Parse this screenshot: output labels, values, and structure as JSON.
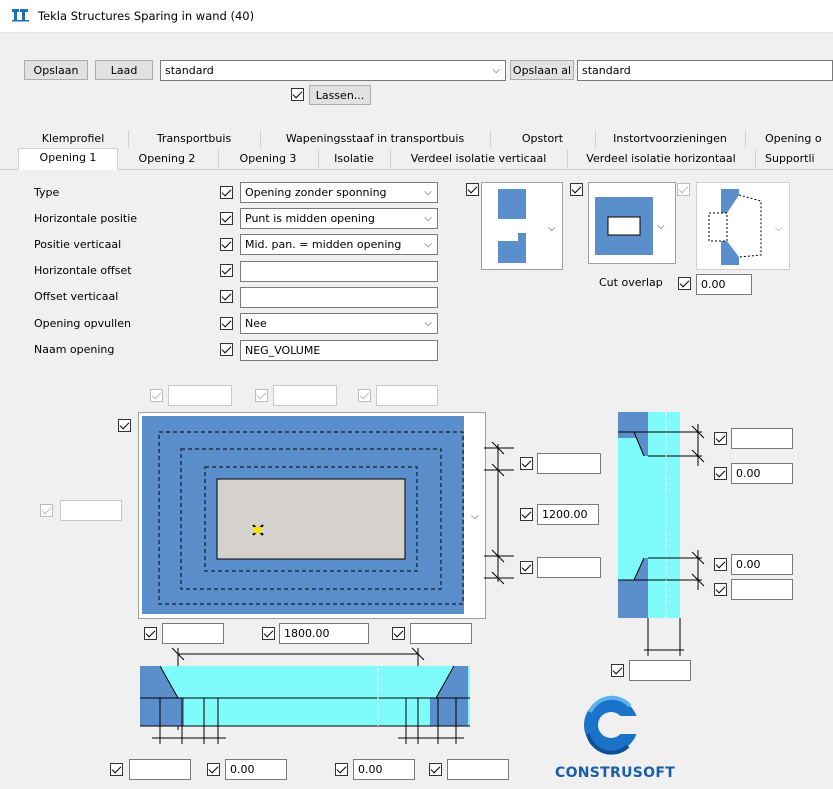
{
  "window": {
    "title": "Tekla Structures  Sparing in wand (40)"
  },
  "toolbar": {
    "save_label": "Opslaan",
    "load_label": "Laad",
    "preset_value": "standard",
    "save_as_label": "Opslaan al",
    "save_as_value": "standard",
    "welds_label": "Lassen..."
  },
  "tabs_row1": [
    "Klemprofiel",
    "Transportbuis",
    "Wapeningsstaaf in transportbuis",
    "Opstort",
    "Instortvoorzieningen",
    "Opening o"
  ],
  "tabs_row2": [
    "Opening 1",
    "Opening 2",
    "Opening 3",
    "Isolatie",
    "Verdeel isolatie verticaal",
    "Verdeel isolatie horizontaal",
    "Supportli"
  ],
  "form": {
    "type_label": "Type",
    "type_value": "Opening zonder sponning",
    "hpos_label": "Horizontale positie",
    "hpos_value": "Punt is midden opening",
    "vpos_label": "Positie verticaal",
    "vpos_value": "Mid. pan. = midden opening",
    "hoffset_label": "Horizontale offset",
    "hoffset_value": "",
    "voffset_label": "Offset verticaal",
    "voffset_value": "",
    "fill_label": "Opening opvullen",
    "fill_value": "Nee",
    "name_label": "Naam opening",
    "name_value": "NEG_VOLUME",
    "cut_overlap_label": "Cut overlap",
    "cut_overlap_value": "0.00"
  },
  "diagram": {
    "width_value": "1800.00",
    "height_value": "1200.00",
    "right_top_value": "0.00",
    "right_bottom_value": "0.00",
    "bottom_a": "0.00",
    "bottom_b": "0.00"
  },
  "logo": {
    "text": "CONSTRUSOFT"
  },
  "colors": {
    "wall_blue": "#5b8fcb",
    "cyan": "#7ffbfb",
    "opening_grey": "#d5d1cc"
  }
}
